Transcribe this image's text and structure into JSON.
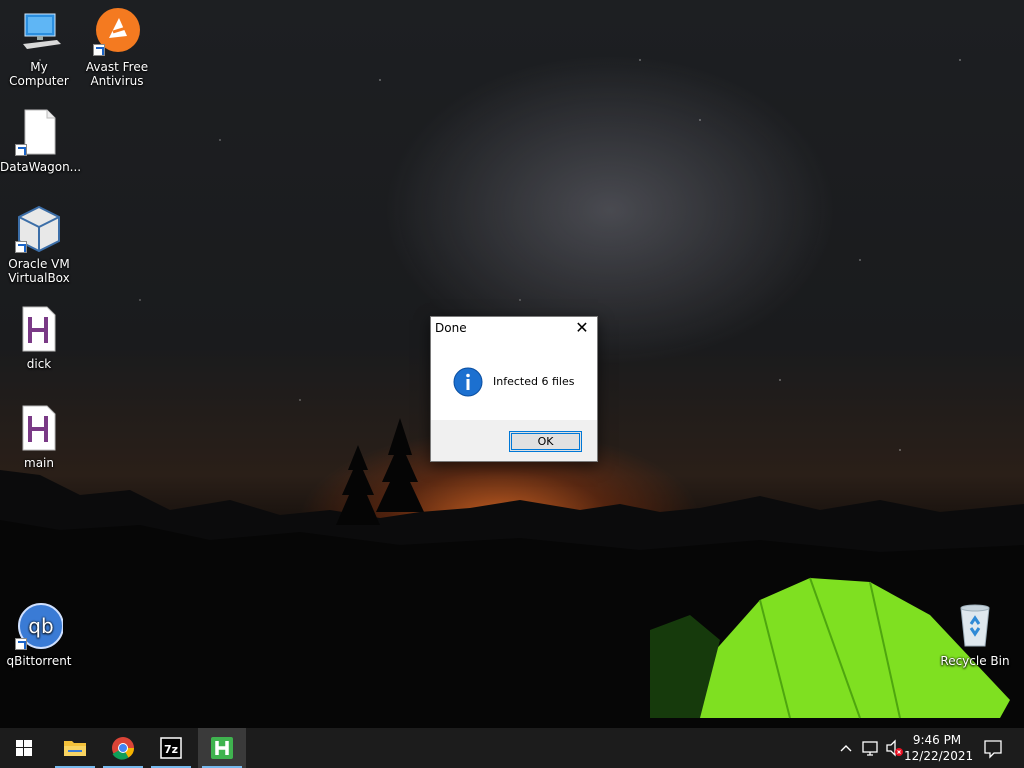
{
  "desktop": {
    "icons": [
      {
        "label": "My Computer"
      },
      {
        "label": "Avast Free Antivirus"
      },
      {
        "label": "DataWagon..."
      },
      {
        "label": "Oracle VM VirtualBox"
      },
      {
        "label": "dick"
      },
      {
        "label": "main"
      },
      {
        "label": "qBittorrent"
      },
      {
        "label": "Recycle Bin"
      }
    ]
  },
  "dialog": {
    "title": "Done",
    "message": "Infected 6 files",
    "ok_label": "OK",
    "close_glyph": "✕",
    "icon": "info-icon"
  },
  "taskbar": {
    "apps": [
      {
        "name": "file-explorer-icon"
      },
      {
        "name": "chrome-icon"
      },
      {
        "name": "7zip-icon"
      },
      {
        "name": "h-app-icon"
      }
    ],
    "clock": {
      "time": "9:46 PM",
      "date": "12/22/2021"
    }
  },
  "colors": {
    "accent": "#0078d7",
    "taskbar": "#1c1c1c",
    "tent": "#7fe021"
  }
}
